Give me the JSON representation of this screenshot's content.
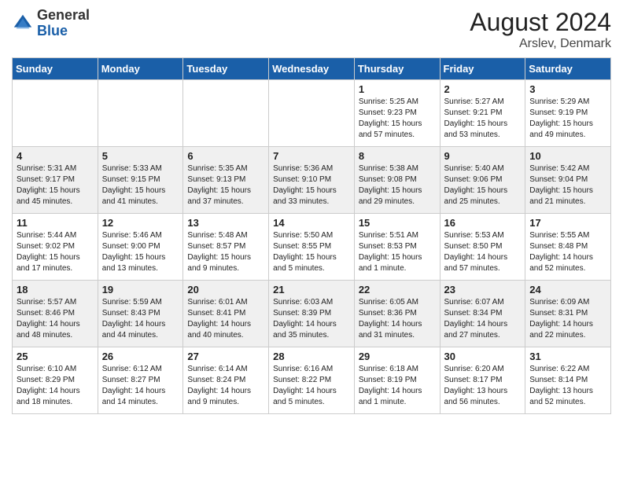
{
  "header": {
    "logo_general": "General",
    "logo_blue": "Blue",
    "title": "August 2024",
    "subtitle": "Arslev, Denmark"
  },
  "days_of_week": [
    "Sunday",
    "Monday",
    "Tuesday",
    "Wednesday",
    "Thursday",
    "Friday",
    "Saturday"
  ],
  "weeks": [
    [
      {
        "day": "",
        "info": ""
      },
      {
        "day": "",
        "info": ""
      },
      {
        "day": "",
        "info": ""
      },
      {
        "day": "",
        "info": ""
      },
      {
        "day": "1",
        "info": "Sunrise: 5:25 AM\nSunset: 9:23 PM\nDaylight: 15 hours\nand 57 minutes."
      },
      {
        "day": "2",
        "info": "Sunrise: 5:27 AM\nSunset: 9:21 PM\nDaylight: 15 hours\nand 53 minutes."
      },
      {
        "day": "3",
        "info": "Sunrise: 5:29 AM\nSunset: 9:19 PM\nDaylight: 15 hours\nand 49 minutes."
      }
    ],
    [
      {
        "day": "4",
        "info": "Sunrise: 5:31 AM\nSunset: 9:17 PM\nDaylight: 15 hours\nand 45 minutes."
      },
      {
        "day": "5",
        "info": "Sunrise: 5:33 AM\nSunset: 9:15 PM\nDaylight: 15 hours\nand 41 minutes."
      },
      {
        "day": "6",
        "info": "Sunrise: 5:35 AM\nSunset: 9:13 PM\nDaylight: 15 hours\nand 37 minutes."
      },
      {
        "day": "7",
        "info": "Sunrise: 5:36 AM\nSunset: 9:10 PM\nDaylight: 15 hours\nand 33 minutes."
      },
      {
        "day": "8",
        "info": "Sunrise: 5:38 AM\nSunset: 9:08 PM\nDaylight: 15 hours\nand 29 minutes."
      },
      {
        "day": "9",
        "info": "Sunrise: 5:40 AM\nSunset: 9:06 PM\nDaylight: 15 hours\nand 25 minutes."
      },
      {
        "day": "10",
        "info": "Sunrise: 5:42 AM\nSunset: 9:04 PM\nDaylight: 15 hours\nand 21 minutes."
      }
    ],
    [
      {
        "day": "11",
        "info": "Sunrise: 5:44 AM\nSunset: 9:02 PM\nDaylight: 15 hours\nand 17 minutes."
      },
      {
        "day": "12",
        "info": "Sunrise: 5:46 AM\nSunset: 9:00 PM\nDaylight: 15 hours\nand 13 minutes."
      },
      {
        "day": "13",
        "info": "Sunrise: 5:48 AM\nSunset: 8:57 PM\nDaylight: 15 hours\nand 9 minutes."
      },
      {
        "day": "14",
        "info": "Sunrise: 5:50 AM\nSunset: 8:55 PM\nDaylight: 15 hours\nand 5 minutes."
      },
      {
        "day": "15",
        "info": "Sunrise: 5:51 AM\nSunset: 8:53 PM\nDaylight: 15 hours\nand 1 minute."
      },
      {
        "day": "16",
        "info": "Sunrise: 5:53 AM\nSunset: 8:50 PM\nDaylight: 14 hours\nand 57 minutes."
      },
      {
        "day": "17",
        "info": "Sunrise: 5:55 AM\nSunset: 8:48 PM\nDaylight: 14 hours\nand 52 minutes."
      }
    ],
    [
      {
        "day": "18",
        "info": "Sunrise: 5:57 AM\nSunset: 8:46 PM\nDaylight: 14 hours\nand 48 minutes."
      },
      {
        "day": "19",
        "info": "Sunrise: 5:59 AM\nSunset: 8:43 PM\nDaylight: 14 hours\nand 44 minutes."
      },
      {
        "day": "20",
        "info": "Sunrise: 6:01 AM\nSunset: 8:41 PM\nDaylight: 14 hours\nand 40 minutes."
      },
      {
        "day": "21",
        "info": "Sunrise: 6:03 AM\nSunset: 8:39 PM\nDaylight: 14 hours\nand 35 minutes."
      },
      {
        "day": "22",
        "info": "Sunrise: 6:05 AM\nSunset: 8:36 PM\nDaylight: 14 hours\nand 31 minutes."
      },
      {
        "day": "23",
        "info": "Sunrise: 6:07 AM\nSunset: 8:34 PM\nDaylight: 14 hours\nand 27 minutes."
      },
      {
        "day": "24",
        "info": "Sunrise: 6:09 AM\nSunset: 8:31 PM\nDaylight: 14 hours\nand 22 minutes."
      }
    ],
    [
      {
        "day": "25",
        "info": "Sunrise: 6:10 AM\nSunset: 8:29 PM\nDaylight: 14 hours\nand 18 minutes."
      },
      {
        "day": "26",
        "info": "Sunrise: 6:12 AM\nSunset: 8:27 PM\nDaylight: 14 hours\nand 14 minutes."
      },
      {
        "day": "27",
        "info": "Sunrise: 6:14 AM\nSunset: 8:24 PM\nDaylight: 14 hours\nand 9 minutes."
      },
      {
        "day": "28",
        "info": "Sunrise: 6:16 AM\nSunset: 8:22 PM\nDaylight: 14 hours\nand 5 minutes."
      },
      {
        "day": "29",
        "info": "Sunrise: 6:18 AM\nSunset: 8:19 PM\nDaylight: 14 hours\nand 1 minute."
      },
      {
        "day": "30",
        "info": "Sunrise: 6:20 AM\nSunset: 8:17 PM\nDaylight: 13 hours\nand 56 minutes."
      },
      {
        "day": "31",
        "info": "Sunrise: 6:22 AM\nSunset: 8:14 PM\nDaylight: 13 hours\nand 52 minutes."
      }
    ]
  ]
}
